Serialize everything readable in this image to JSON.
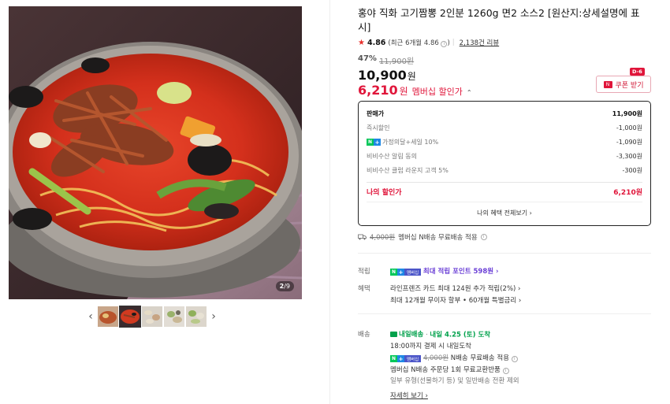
{
  "gallery": {
    "counter_current": "2",
    "counter_total": "/9",
    "prev_arrow": "‹",
    "next_arrow": "›",
    "thumbs": [
      "thumb-1",
      "thumb-2",
      "thumb-3",
      "thumb-4",
      "thumb-5"
    ],
    "active_thumb": 1
  },
  "product": {
    "title": "홍야 직화 고기짬뽕 2인분 1260g 면2 소스2 [원산지:상세설명에 표시]",
    "rating": "4.86",
    "rating_recent": "(최근 6개월 4.86",
    "rating_recent_close": ")",
    "review_count": "2,138건 리뷰",
    "discount_pct": "47%",
    "original_price": "11,900원",
    "price": "10,900",
    "price_unit": "원",
    "member_price": "6,210",
    "member_unit": "원",
    "member_label": "멤버십 할인가",
    "member_caret": "⌃"
  },
  "coupon": {
    "label": "쿠폰 받기",
    "dday": "D-6",
    "icon": "coupon-icon"
  },
  "breakdown": {
    "rows": [
      {
        "label": "판매가",
        "value": "11,900원"
      },
      {
        "label": "즉시할인",
        "value": "-1,000원"
      },
      {
        "label": "가정의달+세일 10%",
        "value": "-1,090원"
      },
      {
        "label": "비비수산 알림 동의",
        "value": "-3,300원"
      },
      {
        "label": "비비수산 클럽 라운지 고객 5%",
        "value": "-300원"
      }
    ],
    "total_label": "나의 할인가",
    "total_value": "6,210원",
    "view_all": "나의 혜택 전체보기 ›"
  },
  "shipping_note": {
    "orig": "4,000원",
    "text": "멤버십 N배송 무료배송 적용"
  },
  "benefits": {
    "points_label": "적립",
    "points_text": "최대 적립 포인트 598원 ›",
    "perk_label": "혜택",
    "perk_line1": "라인프렌즈 카드 최대 124원 추가 적립(2%) ›",
    "perk_line2": "최대 12개월 무이자 할부 • 60개월 특별금리 ›"
  },
  "delivery": {
    "label": "배송",
    "tomorrow_badge": "내일배송",
    "tomorrow_sep": "·",
    "tomorrow_date": "내일 4.25 (토) 도착",
    "line_cutoff": "18:00까지 결제 시 내일도착",
    "free_orig": "4,000원",
    "free_text": "N배송 무료배송 적용",
    "return_text": "멤버십 N배송 주문당 1회 무료교환반품",
    "exclude_text": "일부 유형(선물하기 등) 및 일반배송 전환 제외",
    "more": "자세히 보기 ›"
  },
  "npay_badge": {
    "n": "N",
    "plus": "+",
    "member": "멤버십"
  },
  "colors": {
    "accent_red": "#e0153a",
    "naver_green": "#03c75a",
    "points_purple": "#6a3fd6"
  }
}
